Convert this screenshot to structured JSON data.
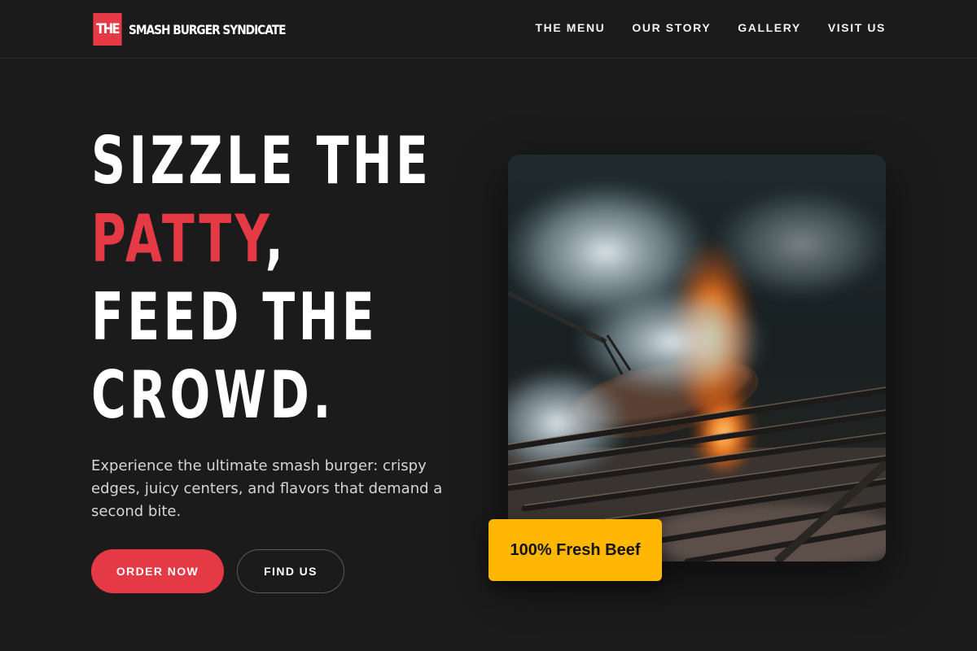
{
  "brand": {
    "mark": "THE",
    "name": "SMASH BURGER SYNDICATE"
  },
  "nav": [
    {
      "label": "THE MENU"
    },
    {
      "label": "OUR STORY"
    },
    {
      "label": "GALLERY"
    },
    {
      "label": "VISIT US"
    }
  ],
  "hero": {
    "headline": {
      "line1": "SIZZLE THE",
      "line2_accent": "PATTY",
      "line2_rest": ",",
      "line3": "FEED THE",
      "line4": "CROWD."
    },
    "description": "Experience the ultimate smash burger: crispy edges, juicy centers, and flavors that demand a second bite.",
    "cta_primary": "ORDER NOW",
    "cta_secondary": "FIND US",
    "image_icon": "grill-flame-photo",
    "badge": "100% Fresh Beef"
  },
  "colors": {
    "background": "#1b1b1b",
    "accent": "#e63946",
    "badge": "#ffb703"
  }
}
